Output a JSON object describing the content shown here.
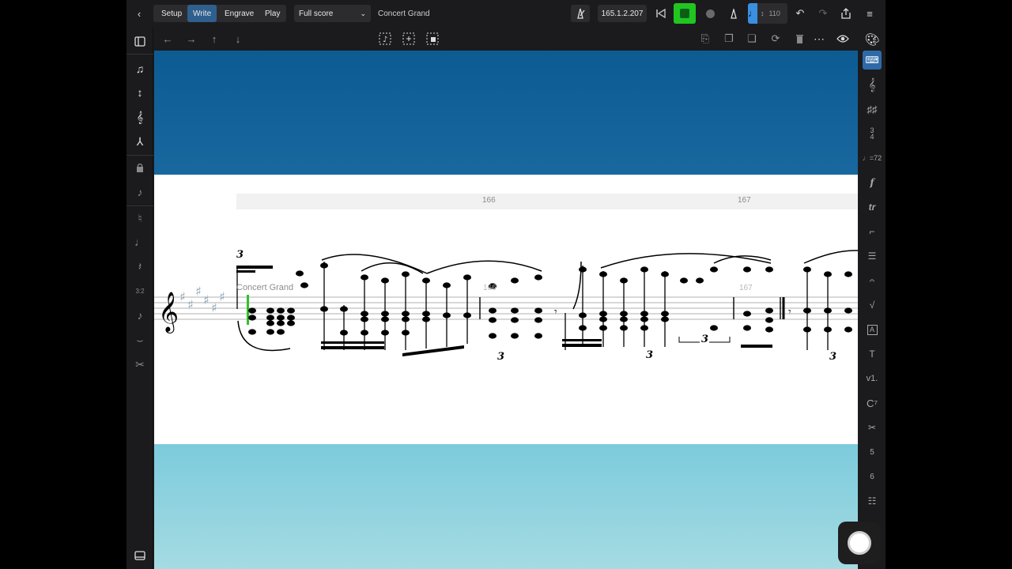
{
  "toolbar": {
    "modes": {
      "setup": "Setup",
      "write": "Write",
      "engrave": "Engrave",
      "play": "Play"
    },
    "active_mode": "Write",
    "layout_select": "Full score",
    "project_title": "Concert Grand",
    "position": "165.1.2.207",
    "tempo": "110",
    "colors": {
      "record_active": "#22c51f",
      "accent": "#2f6aa8"
    }
  },
  "score": {
    "bar_numbers": [
      "166",
      "167"
    ],
    "staff_label": "Concert Grand",
    "inline_bar_numbers": [
      "166",
      "167"
    ],
    "tuplet_labels": [
      "3",
      "3",
      "3",
      "3",
      "3"
    ],
    "colors": {
      "caret": "#2fc22a",
      "background_top": "#0d5b93",
      "background_bottom": "#a5dbe2"
    }
  },
  "icons": {
    "left_panel": [
      "sidebar-toggle-icon",
      "note-input-icon",
      "insert-icon",
      "chord-icon",
      "slash-icon",
      "lock-icon",
      "grace-note-icon",
      "accidental-icon",
      "duration-icon",
      "rest-icon",
      "tuplet-icon",
      "note-icon",
      "tie-icon",
      "scissors-icon",
      "keyboard-panel-icon"
    ],
    "right_panel": [
      "palette-icon",
      "keyboard-icon",
      "clef-icon",
      "key-signature-icon",
      "time-signature-icon",
      "tempo-icon",
      "dynamics-icon",
      "ornaments-icon",
      "repeat-icon",
      "bars-icon",
      "holds-icon",
      "playing-techniques-icon",
      "rehearsal-mark-icon",
      "text-icon",
      "lyrics-icon",
      "chord-symbol-icon",
      "cues-icon",
      "figured-bass-icon",
      "fingering-icon",
      "more-icon"
    ]
  }
}
